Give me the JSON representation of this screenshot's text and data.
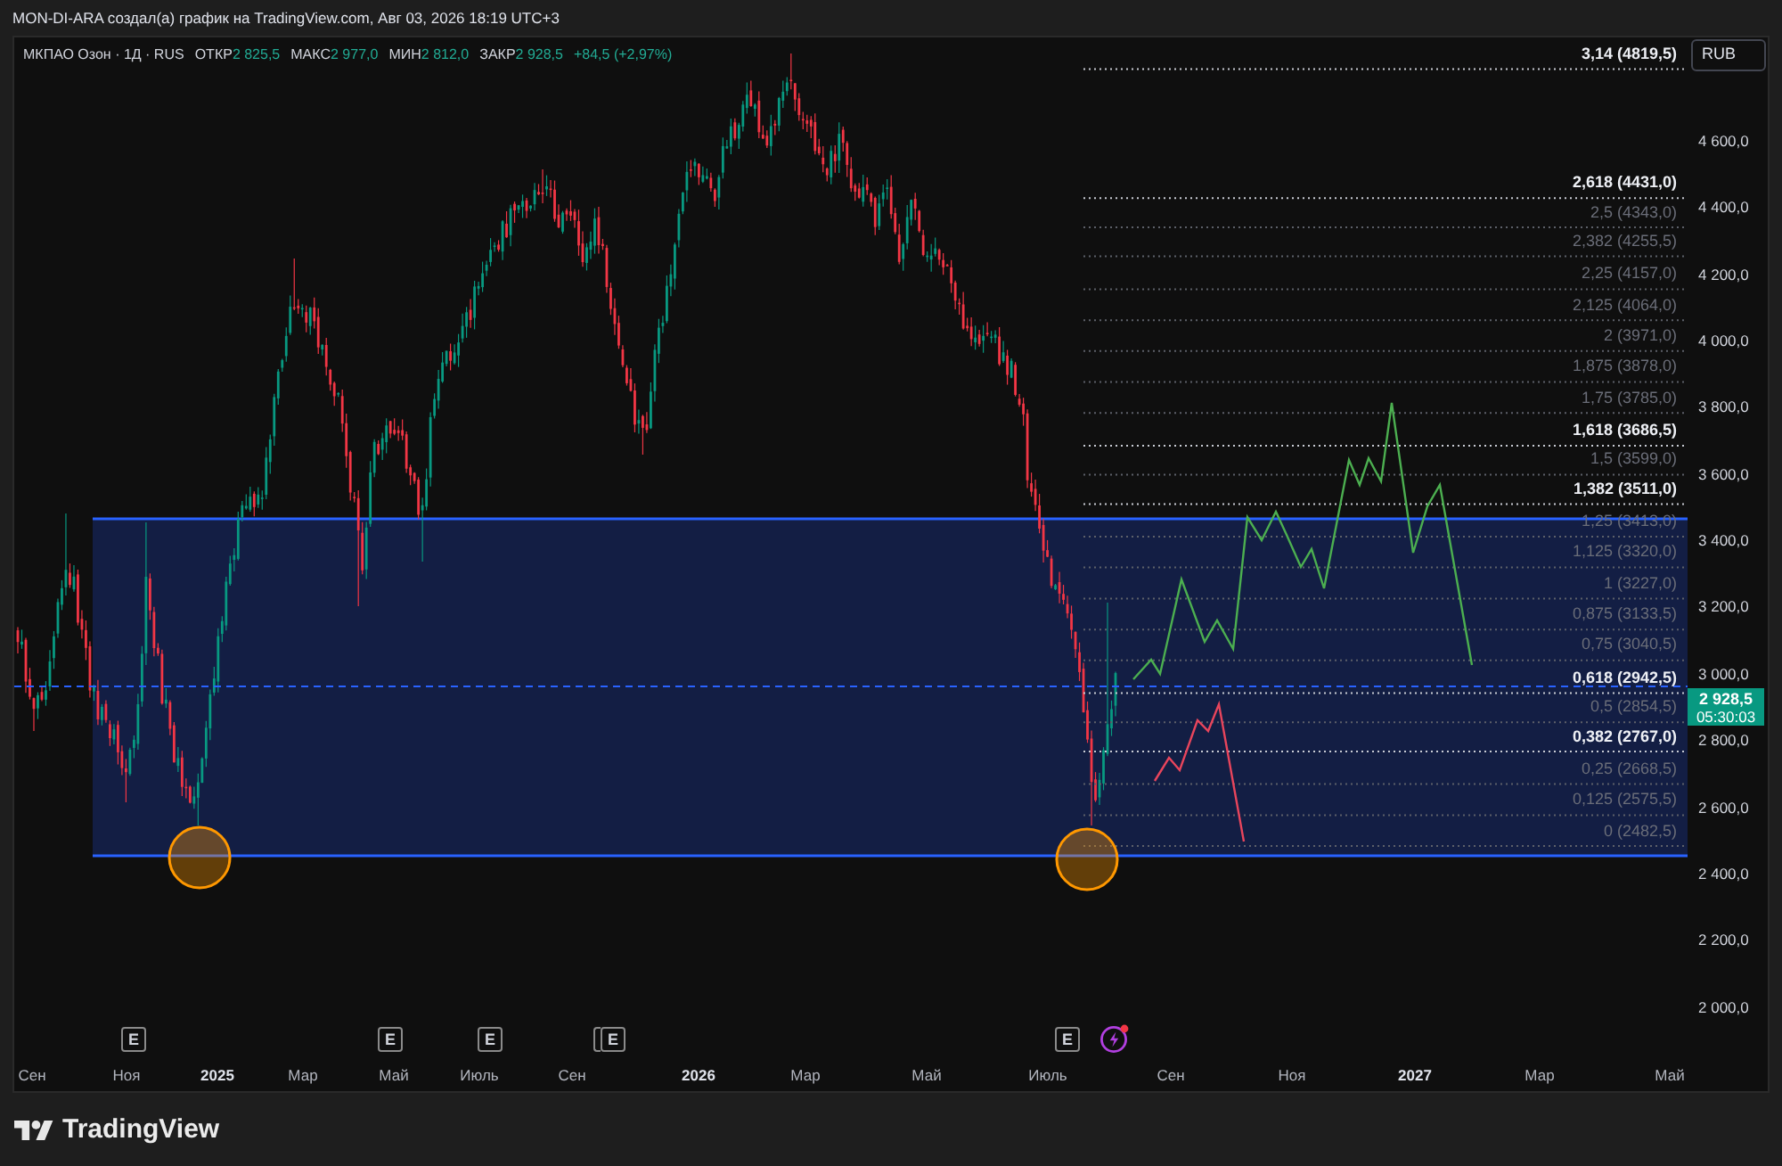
{
  "header": {
    "caption": "MON-DI-ARA создал(а) график на TradingView.com, Авг 03, 2026 18:19 UTC+3"
  },
  "legend": {
    "symbol": "МКПАО Озон · 1Д · RUS",
    "fields": [
      {
        "label": "ОТКР",
        "value": "2 825,5"
      },
      {
        "label": "МАКС",
        "value": "2 977,0"
      },
      {
        "label": "МИН",
        "value": "2 812,0"
      },
      {
        "label": "ЗАКР",
        "value": "2 928,5"
      }
    ],
    "change": "+84,5 (+2,97%)"
  },
  "price_axis": {
    "currency": "RUB",
    "labels": [
      "4 600,0",
      "4 400,0",
      "4 200,0",
      "4 000,0",
      "3 800,0",
      "3 600,0",
      "3 400,0",
      "3 200,0",
      "3 000,0",
      "2 800,0",
      "2 600,0",
      "2 400,0",
      "2 200,0",
      "2 000,0"
    ],
    "current_price": {
      "price": "2 928,5",
      "countdown": "05:30:03"
    }
  },
  "fib_levels": [
    {
      "label": "3,14 (4819,5)",
      "highlighted": true
    },
    {
      "label": "2,618 (4431,0)",
      "highlighted": true
    },
    {
      "label": "2,5 (4343,0)",
      "highlighted": false
    },
    {
      "label": "2,382 (4255,5)",
      "highlighted": false
    },
    {
      "label": "2,25 (4157,0)",
      "highlighted": false
    },
    {
      "label": "2,125 (4064,0)",
      "highlighted": false
    },
    {
      "label": "2 (3971,0)",
      "highlighted": false
    },
    {
      "label": "1,875 (3878,0)",
      "highlighted": false
    },
    {
      "label": "1,75 (3785,0)",
      "highlighted": false
    },
    {
      "label": "1,618 (3686,5)",
      "highlighted": true
    },
    {
      "label": "1,5 (3599,0)",
      "highlighted": false
    },
    {
      "label": "1,382 (3511,0)",
      "highlighted": true
    },
    {
      "label": "1,25 (3413,0)",
      "highlighted": false
    },
    {
      "label": "1,125 (3320,0)",
      "highlighted": false
    },
    {
      "label": "1 (3227,0)",
      "highlighted": false
    },
    {
      "label": "0,875 (3133,5)",
      "highlighted": false
    },
    {
      "label": "0,75 (3040,5)",
      "highlighted": false
    },
    {
      "label": "0,618 (2942,5)",
      "highlighted": true
    },
    {
      "label": "0,5 (2854,5)",
      "highlighted": false
    },
    {
      "label": "0,382 (2767,0)",
      "highlighted": true
    },
    {
      "label": "0,25 (2668,5)",
      "highlighted": false
    },
    {
      "label": "0,125 (2575,5)",
      "highlighted": false
    },
    {
      "label": "0 (2482,5)",
      "highlighted": false
    }
  ],
  "events": [
    {
      "kind": "earnings",
      "label": "E"
    },
    {
      "kind": "earnings",
      "label": "E"
    },
    {
      "kind": "earnings",
      "label": "E"
    },
    {
      "kind": "earnings-stacked",
      "label": "E"
    },
    {
      "kind": "earnings",
      "label": "E"
    },
    {
      "kind": "news"
    }
  ],
  "time_axis": [
    {
      "label": "Сен",
      "major": false
    },
    {
      "label": "Ноя",
      "major": false
    },
    {
      "label": "2025",
      "major": true
    },
    {
      "label": "Мар",
      "major": false
    },
    {
      "label": "Май",
      "major": false
    },
    {
      "label": "Июль",
      "major": false
    },
    {
      "label": "Сен",
      "major": false
    },
    {
      "label": "2026",
      "major": true
    },
    {
      "label": "Мар",
      "major": false
    },
    {
      "label": "Май",
      "major": false
    },
    {
      "label": "Июль",
      "major": false
    },
    {
      "label": "Сен",
      "major": false
    },
    {
      "label": "Ноя",
      "major": false
    },
    {
      "label": "2027",
      "major": true
    },
    {
      "label": "Мар",
      "major": false
    },
    {
      "label": "Май",
      "major": false
    }
  ],
  "footer": {
    "brand": "TradingView"
  }
}
